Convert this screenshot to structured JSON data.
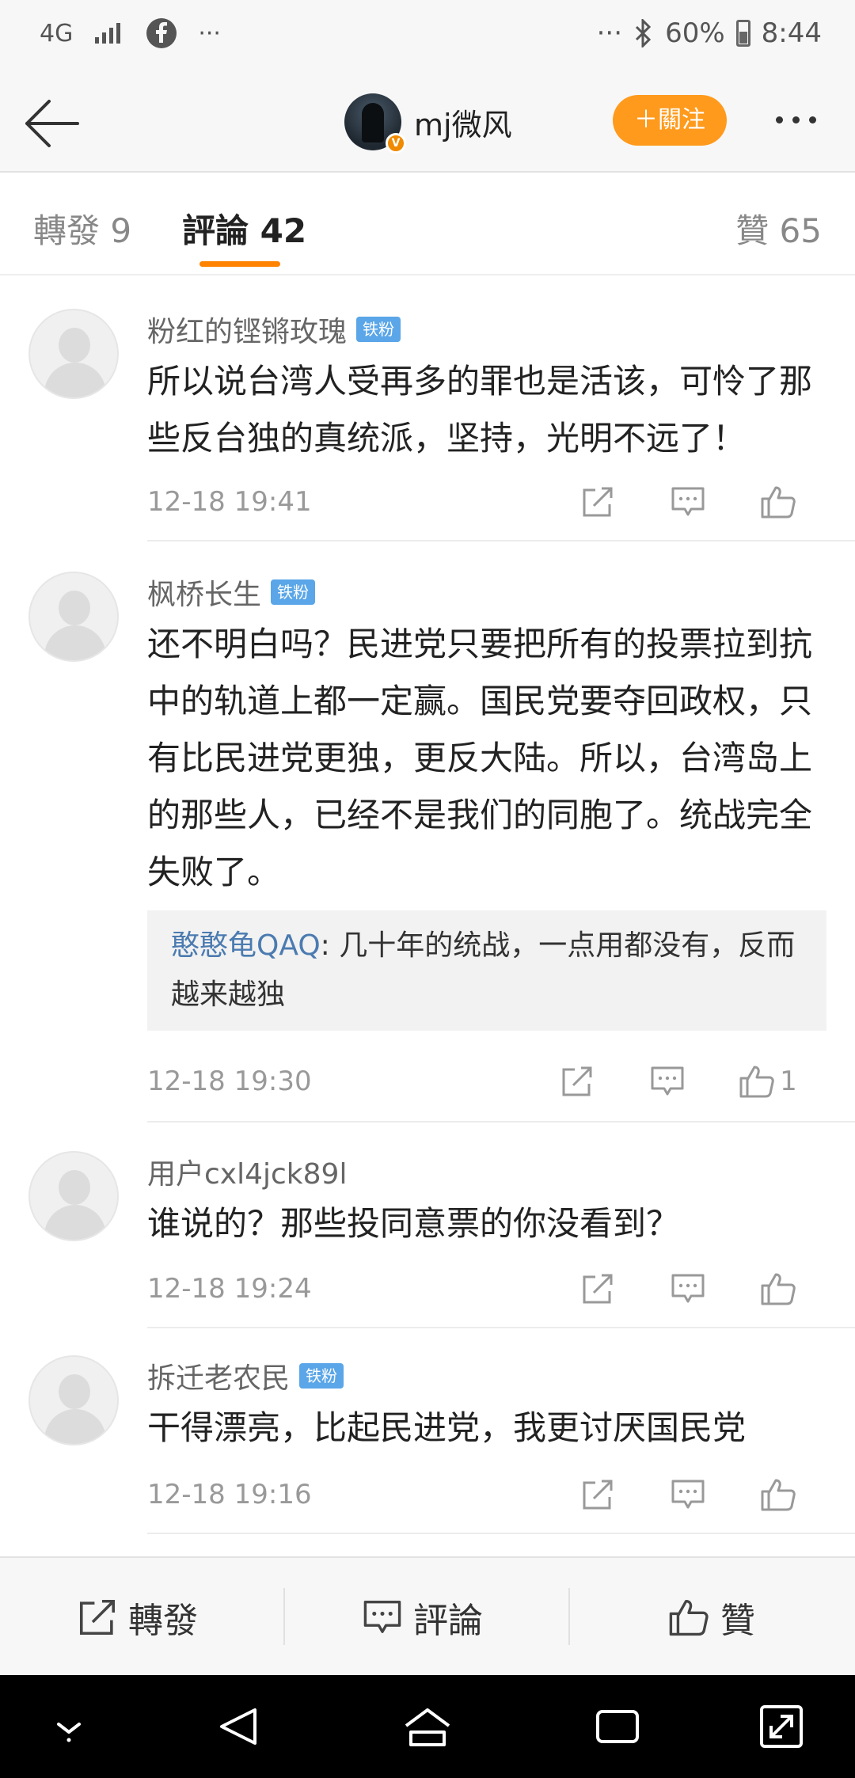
{
  "status_bar": {
    "network": "4G",
    "more_left": "···",
    "more_right": "···",
    "battery": "60%",
    "time": "8:44"
  },
  "header": {
    "username": "mj微风",
    "follow_label": "＋關注"
  },
  "tabs": {
    "repost": "轉發 9",
    "comment": "評論 42",
    "like": "贊 65"
  },
  "comments": [
    {
      "name": "粉红的铿锵玫瑰",
      "badge": "铁粉",
      "text": "所以说台湾人受再多的罪也是活该，可怜了那些反台独的真统派，坚持，光明不远了！",
      "time": "12-18 19:41",
      "likes": ""
    },
    {
      "name": "枫桥长生",
      "badge": "铁粉",
      "text": "还不明白吗？民进党只要把所有的投票拉到抗中的轨道上都一定赢。国民党要夺回政权，只有比民进党更独，更反大陆。所以，台湾岛上的那些人，已经不是我们的同胞了。统战完全失败了。",
      "quote": {
        "name": "憨憨龟QAQ",
        "text": ": 几十年的统战，一点用都没有，反而越来越独"
      },
      "time": "12-18 19:30",
      "likes": "1"
    },
    {
      "name": "用户cxl4jck89l",
      "badge": "",
      "text": "谁说的？那些投同意票的你没看到？",
      "time": "12-18 19:24",
      "likes": ""
    },
    {
      "name": "拆迁老农民",
      "badge": "铁粉",
      "text": "干得漂亮，比起民进党，我更讨厌国民党",
      "time": "12-18 19:16",
      "likes": ""
    }
  ],
  "bottom_bar": {
    "repost": "轉發",
    "comment": "評論",
    "like": "贊"
  },
  "colors": {
    "accent": "#ff8200",
    "follow_button": "#ff9a1c",
    "fan_badge": "#5aa6e8",
    "quote_name": "#4b7bb0"
  }
}
